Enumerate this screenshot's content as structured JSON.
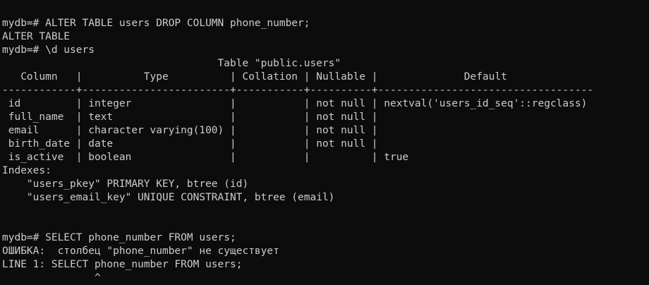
{
  "terminal": {
    "lines": [
      "mydb=# ALTER TABLE users DROP COLUMN phone_number;",
      "ALTER TABLE",
      "mydb=# \\d users",
      "                                   Table \"public.users\"",
      "   Column   |          Type          | Collation | Nullable |              Default",
      "------------+------------------------+-----------+----------+-----------------------------------",
      " id         | integer                |           | not null | nextval('users_id_seq'::regclass)",
      " full_name  | text                   |           | not null |",
      " email      | character varying(100) |           | not null |",
      " birth_date | date                   |           | not null |",
      " is_active  | boolean                |           |          | true",
      "Indexes:",
      "    \"users_pkey\" PRIMARY KEY, btree (id)",
      "    \"users_email_key\" UNIQUE CONSTRAINT, btree (email)",
      "",
      "",
      "mydb=# SELECT phone_number FROM users;",
      "ОШИБКА:  столбец \"phone_number\" не существует",
      "LINE 1: SELECT phone_number FROM users;",
      "               ^"
    ]
  }
}
